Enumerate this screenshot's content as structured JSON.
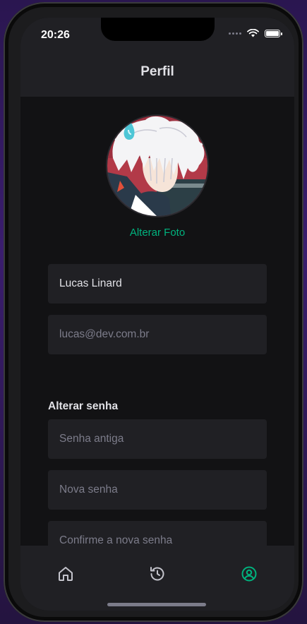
{
  "status_bar": {
    "time": "20:26"
  },
  "header": {
    "title": "Perfil"
  },
  "profile": {
    "change_photo_label": "Alterar Foto",
    "name_value": "Lucas Linard",
    "email_placeholder": "lucas@dev.com.br"
  },
  "password_section": {
    "title": "Alterar senha",
    "old_password_placeholder": "Senha antiga",
    "new_password_placeholder": "Nova senha",
    "confirm_password_placeholder": "Confirme a nova senha"
  },
  "tabbar": {
    "items": [
      {
        "icon": "home-icon",
        "active": false
      },
      {
        "icon": "history-icon",
        "active": false
      },
      {
        "icon": "user-circle-icon",
        "active": true
      }
    ],
    "active_color": "#00b37e",
    "inactive_color": "#c4c4cc"
  },
  "colors": {
    "background": "#121214",
    "surface": "#202024",
    "accent": "#00b37e",
    "text": "#e1e1e6",
    "placeholder": "#7c7c8a"
  }
}
